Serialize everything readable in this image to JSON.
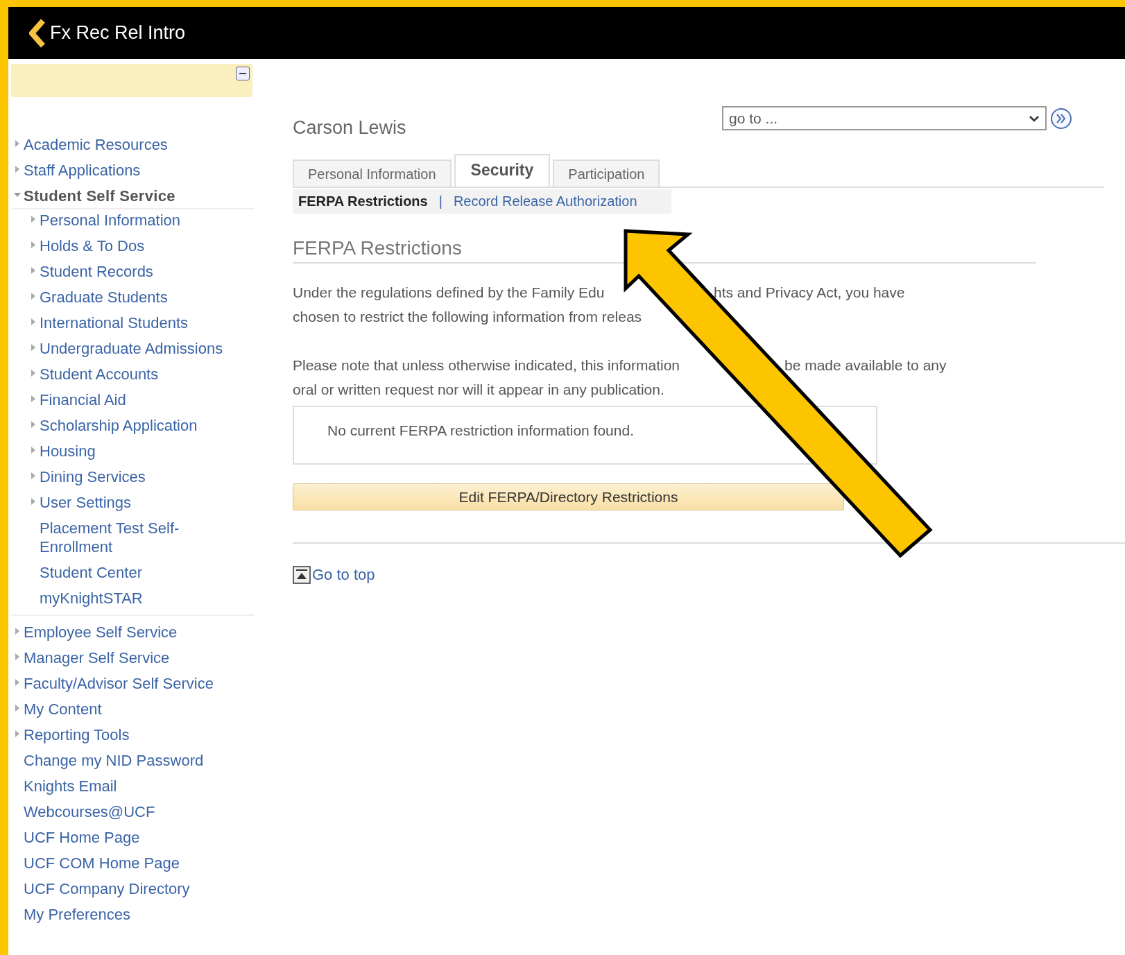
{
  "header": {
    "title": "Fx Rec Rel Intro"
  },
  "sidebar": {
    "items": [
      {
        "label": "Academic Resources",
        "kind": "folder",
        "expanded": false
      },
      {
        "label": "Staff Applications",
        "kind": "folder",
        "expanded": false
      },
      {
        "label": "Student Self Service",
        "kind": "folder",
        "expanded": true,
        "children": [
          {
            "label": "Personal Information",
            "kind": "folder",
            "expanded": false
          },
          {
            "label": "Holds & To Dos",
            "kind": "folder",
            "expanded": false
          },
          {
            "label": "Student Records",
            "kind": "folder",
            "expanded": false
          },
          {
            "label": "Graduate Students",
            "kind": "folder",
            "expanded": false
          },
          {
            "label": "International Students",
            "kind": "folder",
            "expanded": false
          },
          {
            "label": "Undergraduate Admissions",
            "kind": "folder",
            "expanded": false
          },
          {
            "label": "Student Accounts",
            "kind": "folder",
            "expanded": false
          },
          {
            "label": "Financial Aid",
            "kind": "folder",
            "expanded": false
          },
          {
            "label": "Scholarship Application",
            "kind": "folder",
            "expanded": false
          },
          {
            "label": "Housing",
            "kind": "folder",
            "expanded": false
          },
          {
            "label": "Dining Services",
            "kind": "folder",
            "expanded": false
          },
          {
            "label": "User Settings",
            "kind": "folder",
            "expanded": false
          },
          {
            "label": "Placement Test Self-Enrollment",
            "kind": "link"
          },
          {
            "label": "Student Center",
            "kind": "link"
          },
          {
            "label": "myKnightSTAR",
            "kind": "link"
          }
        ]
      },
      {
        "label": "Employee Self Service",
        "kind": "folder",
        "expanded": false
      },
      {
        "label": "Manager Self Service",
        "kind": "folder",
        "expanded": false
      },
      {
        "label": "Faculty/Advisor Self Service",
        "kind": "folder",
        "expanded": false
      },
      {
        "label": "My Content",
        "kind": "folder",
        "expanded": false
      },
      {
        "label": "Reporting Tools",
        "kind": "folder",
        "expanded": false
      },
      {
        "label": "Change my NID Password",
        "kind": "link"
      },
      {
        "label": "Knights Email",
        "kind": "link"
      },
      {
        "label": "Webcourses@UCF",
        "kind": "link"
      },
      {
        "label": "UCF Home Page",
        "kind": "link"
      },
      {
        "label": "UCF COM Home Page",
        "kind": "link"
      },
      {
        "label": "UCF Company Directory",
        "kind": "link"
      },
      {
        "label": "My Preferences",
        "kind": "link"
      }
    ]
  },
  "main": {
    "person": "Carson Lewis",
    "goto": {
      "value": "go to ..."
    },
    "tabs": [
      {
        "label": "Personal Information",
        "selected": false
      },
      {
        "label": "Security",
        "selected": true
      },
      {
        "label": "Participation",
        "selected": false
      }
    ],
    "subtabs": [
      {
        "label": "FERPA Restrictions",
        "selected": true
      },
      {
        "label": "Record Release Authorization",
        "selected": false
      }
    ],
    "subtab_separator": "|",
    "section_title": "FERPA Restrictions",
    "paragraphs": [
      {
        "lines": [
          {
            "left": "Under the regulations defined by the Family Edu",
            "right": "hts and Privacy Act, you have"
          },
          {
            "left": "chosen to restrict the following information from releas"
          }
        ]
      },
      {
        "lines": [
          {
            "left": "Please note that unless otherwise indicated, this information",
            "right": "be made available to any"
          },
          {
            "left": "oral or written request nor will it appear in any publication."
          }
        ]
      }
    ],
    "message": "No current FERPA restriction information found.",
    "edit_button": "Edit FERPA/Directory Restrictions",
    "go_to_top": "Go to top"
  }
}
